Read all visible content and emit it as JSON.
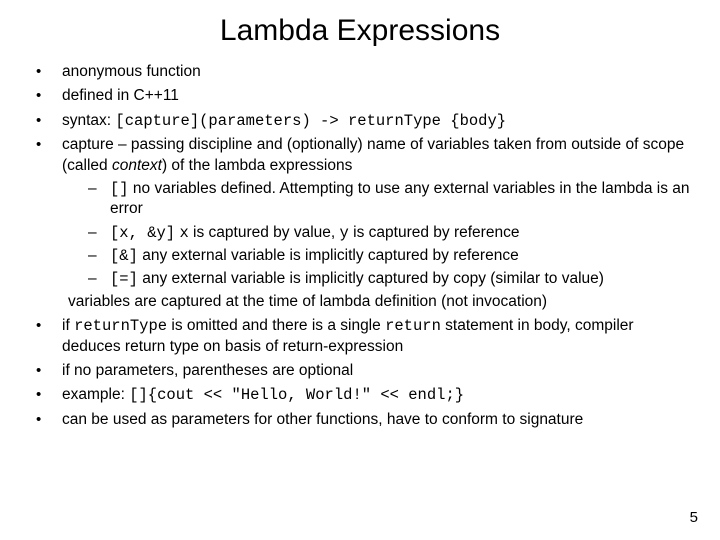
{
  "title": "Lambda Expressions",
  "b1": "anonymous function",
  "b2": "defined in C++11",
  "b3_pre": "syntax: ",
  "b3_code": "[capture](parameters) -> returnType {body}",
  "b4_a": "capture – passing discipline and (optionally) name of variables taken from outside of scope (called ",
  "b4_em": "context",
  "b4_b": ") of the lambda expressions",
  "s1_code": "[]",
  "s1_txt": "   no variables defined. Attempting to use any external variables in the lambda is an error",
  "s2_code": "[x, &y]",
  "s2_mid_a": " ",
  "s2_x": "x",
  "s2_mid_b": " is captured by value, ",
  "s2_y": "y",
  "s2_end": " is captured by reference",
  "s3_code": "[&]",
  "s3_txt": " any external variable is implicitly captured by reference",
  "s4_code": "[=]",
  "s4_txt": " any external variable is implicitly captured by copy (similar to value)",
  "b4_cont": "variables are captured at the time of lambda definition (not invocation)",
  "b5_a": "if ",
  "b5_code1": "returnType",
  "b5_b": " is omitted and there is a single ",
  "b5_code2": "return",
  "b5_c": " statement in body, compiler deduces return type on basis of return-expression",
  "b6": "if no parameters, parentheses are optional",
  "b7_pre": "example: ",
  "b7_code": "[]{cout << \"Hello, World!\" << endl;}",
  "b8": "can be used as parameters for other functions, have to conform to signature",
  "pagenum": "5"
}
